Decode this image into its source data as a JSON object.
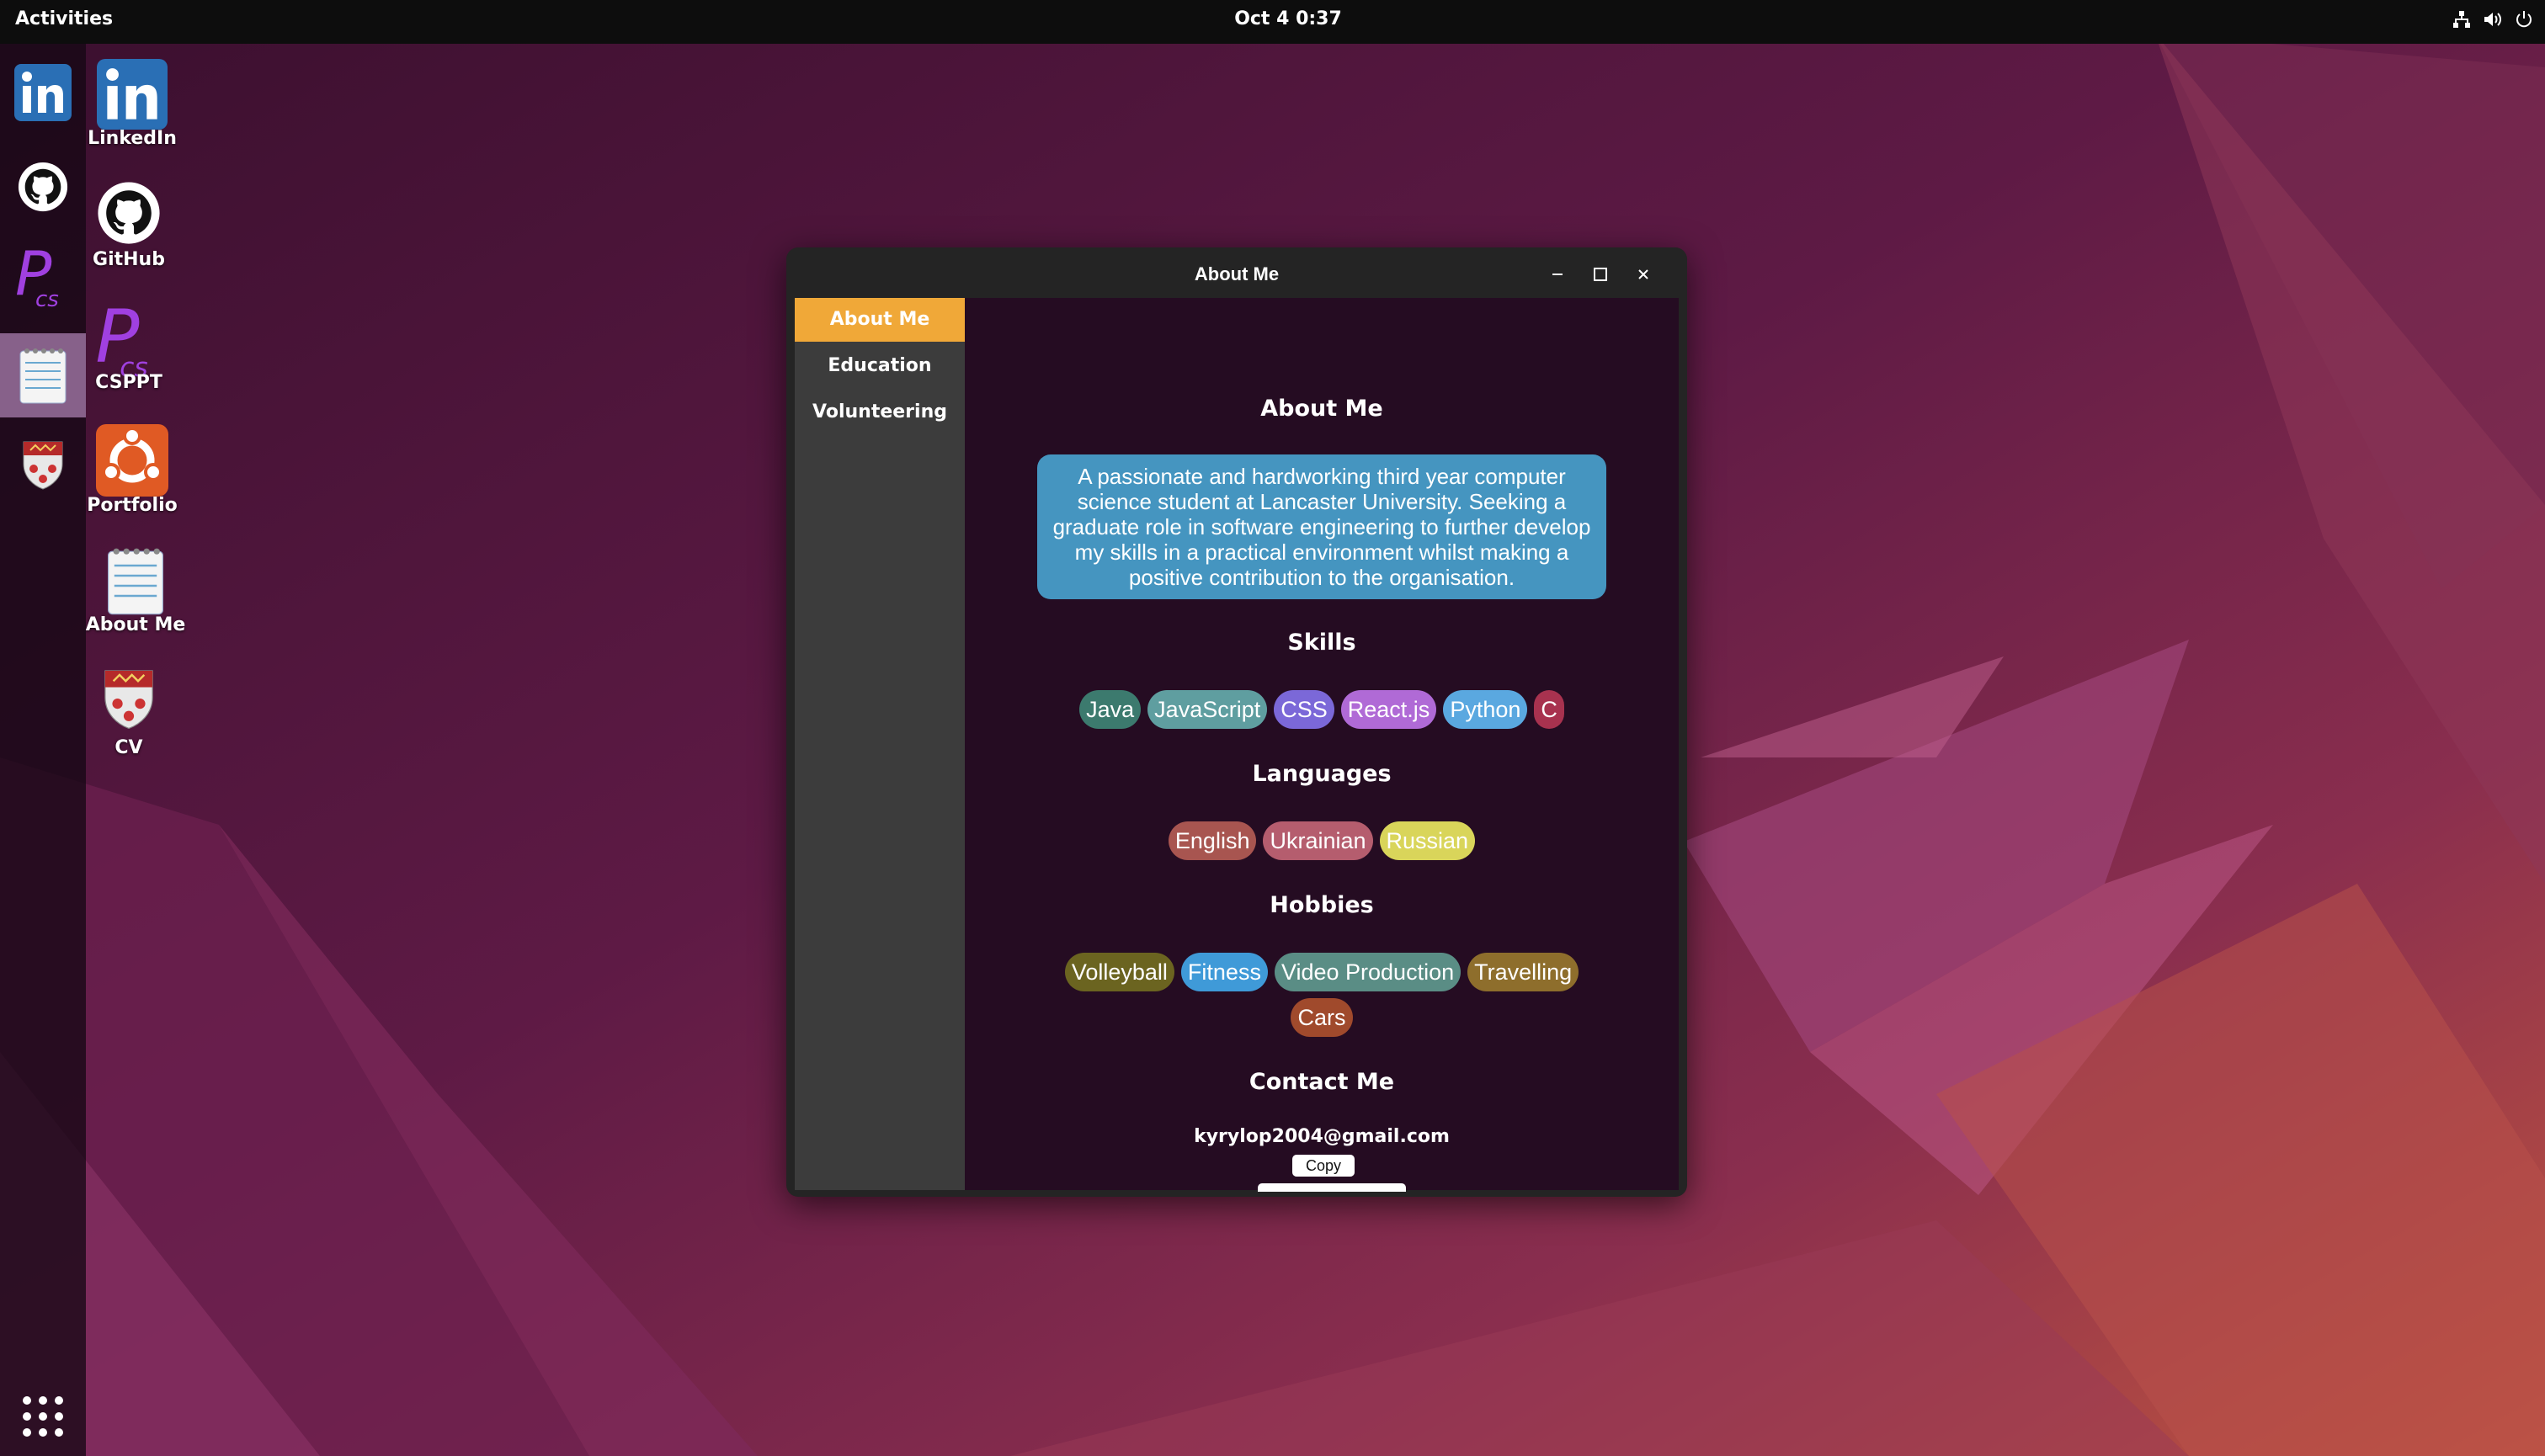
{
  "topbar": {
    "activities": "Activities",
    "clock": "Oct 4  0:37",
    "tray_icons": [
      "network-icon",
      "volume-icon",
      "power-icon"
    ]
  },
  "dock": {
    "items": [
      {
        "name": "dock-linkedin",
        "icon": "linkedin-icon"
      },
      {
        "name": "dock-github",
        "icon": "github-icon"
      },
      {
        "name": "dock-csppt",
        "icon": "csppt-icon"
      },
      {
        "name": "dock-about-me",
        "icon": "notepad-icon",
        "active": true
      },
      {
        "name": "dock-cv",
        "icon": "crest-icon"
      }
    ],
    "apps_grid_icon": "apps-grid-icon"
  },
  "desktop": {
    "icons": [
      {
        "label": "LinkedIn",
        "icon": "linkedin-icon"
      },
      {
        "label": "GitHub",
        "icon": "github-icon"
      },
      {
        "label": "CSPPT",
        "icon": "csppt-icon"
      },
      {
        "label": "Portfolio",
        "icon": "ubuntu-icon"
      },
      {
        "label": "About Me",
        "icon": "notepad-icon"
      },
      {
        "label": "CV",
        "icon": "crest-icon"
      }
    ]
  },
  "window": {
    "title": "About Me",
    "sidebar": [
      {
        "label": "About Me",
        "active": true
      },
      {
        "label": "Education",
        "active": false
      },
      {
        "label": "Volunteering",
        "active": false
      }
    ],
    "about": {
      "heading": "About Me",
      "bio": "A passionate and hardworking third year computer science student at Lancaster University. Seeking a graduate role in software engineering to further develop my skills in a practical environment whilst making a positive contribution to the organisation."
    },
    "skills": {
      "heading": "Skills",
      "items": [
        {
          "label": "Java",
          "color": "#3c7a6e"
        },
        {
          "label": "JavaScript",
          "color": "#5f9ea0"
        },
        {
          "label": "CSS",
          "color": "#7b68d8"
        },
        {
          "label": "React.js",
          "color": "#b06ad6"
        },
        {
          "label": "Python",
          "color": "#5aa8e0"
        },
        {
          "label": "C",
          "color": "#a8324f"
        }
      ]
    },
    "languages": {
      "heading": "Languages",
      "items": [
        {
          "label": "English",
          "color": "#a85550"
        },
        {
          "label": "Ukrainian",
          "color": "#b55d6e"
        },
        {
          "label": "Russian",
          "color": "#d9d55a"
        }
      ]
    },
    "hobbies": {
      "heading": "Hobbies",
      "items": [
        {
          "label": "Volleyball",
          "color": "#6b6420"
        },
        {
          "label": "Fitness",
          "color": "#3f9ad8"
        },
        {
          "label": "Video Production",
          "color": "#5a8d85"
        },
        {
          "label": "Travelling",
          "color": "#8e6e2c"
        },
        {
          "label": "Cars",
          "color": "#a04a2c"
        }
      ]
    },
    "contact": {
      "heading": "Contact Me",
      "email": "kyrylop2004@gmail.com",
      "copy_label": "Copy"
    }
  }
}
